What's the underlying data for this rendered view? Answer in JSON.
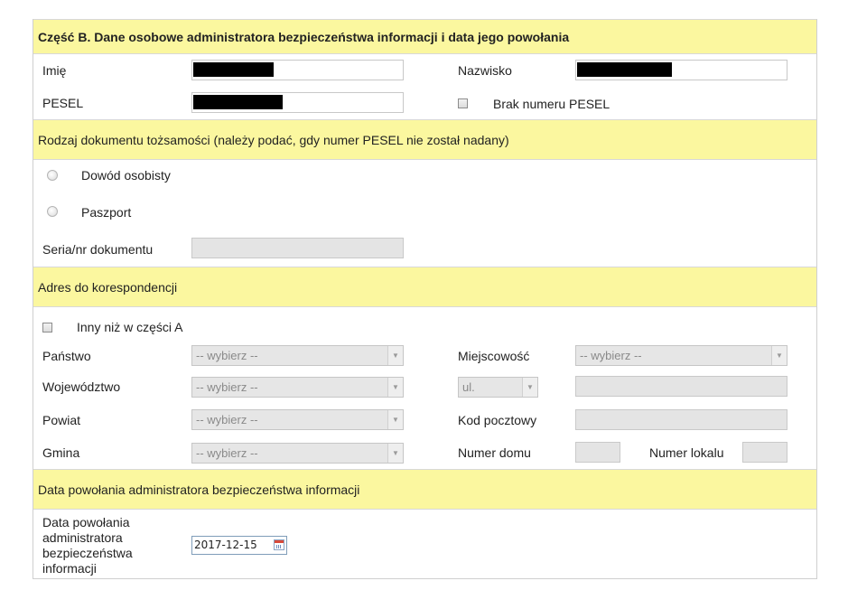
{
  "section_b": {
    "header": "Część B. Dane osobowe administratora bezpieczeństwa informacji i data jego powołania",
    "imie_label": "Imię",
    "nazwisko_label": "Nazwisko",
    "pesel_label": "PESEL",
    "brak_pesel_label": "Brak numeru PESEL"
  },
  "document": {
    "header": "Rodzaj dokumentu tożsamości (należy podać, gdy numer PESEL nie został nadany)",
    "options": [
      "Dowód osobisty",
      "Paszport"
    ],
    "seria_label": "Seria/nr dokumentu"
  },
  "address": {
    "header": "Adres do korespondencji",
    "inny_label": "Inny niż w części A",
    "panstwo_label": "Państwo",
    "wojewodztwo_label": "Województwo",
    "powiat_label": "Powiat",
    "gmina_label": "Gmina",
    "miejscowosc_label": "Miejscowość",
    "kod_label": "Kod pocztowy",
    "numer_domu_label": "Numer domu",
    "numer_lokalu_label": "Numer lokalu",
    "select_placeholder": "-- wybierz --",
    "street_prefix": "ul."
  },
  "appointment": {
    "header": "Data powołania administratora bezpieczeństwa informacji",
    "label_lines": [
      "Data powołania",
      "administratora",
      "bezpieczeństwa",
      "informacji"
    ],
    "date_value": "2017-12-15"
  }
}
